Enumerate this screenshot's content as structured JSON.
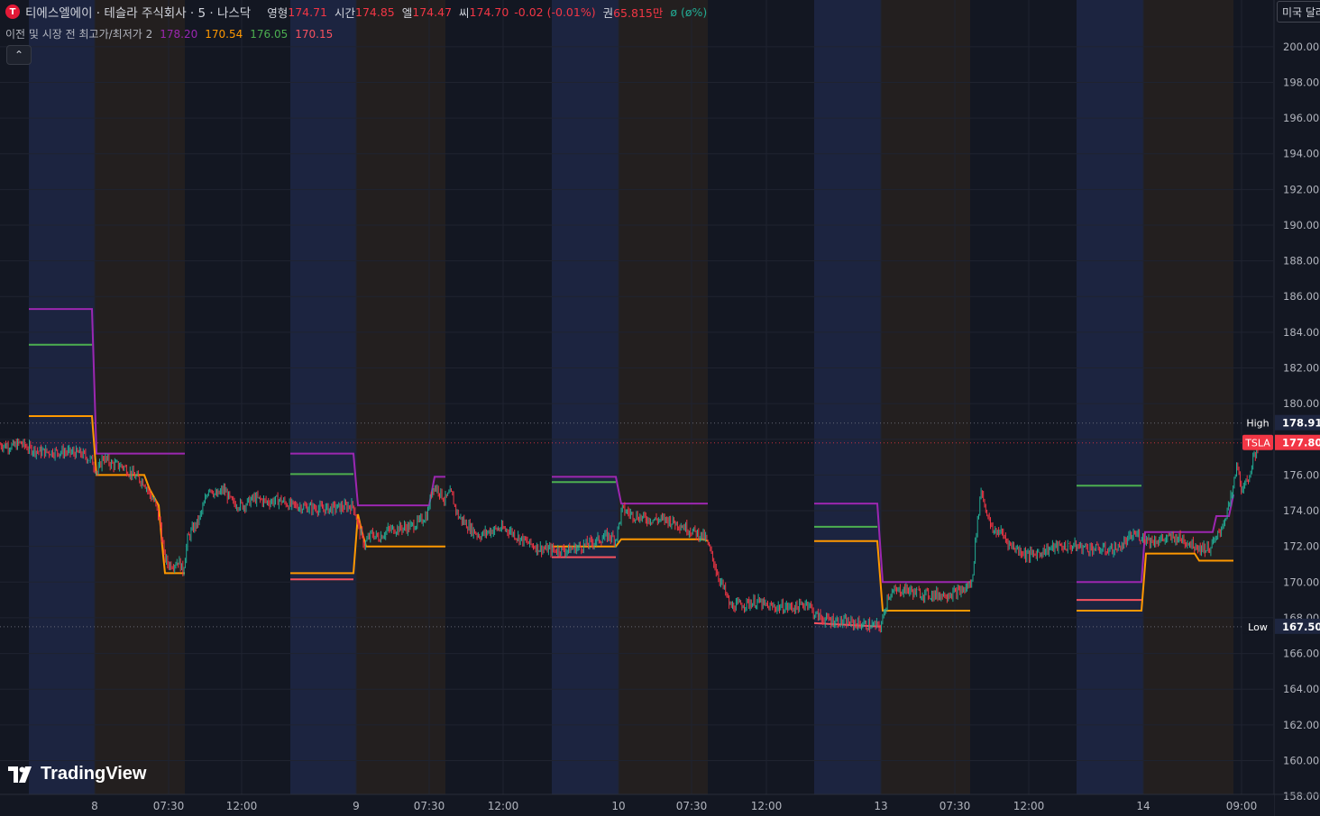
{
  "header": {
    "logo_letter": "T",
    "title": "티에스엘에이 · 테슬라 주식회사 · 5 · 나스닥",
    "ohlc": [
      {
        "label": "영형",
        "value": "174.71"
      },
      {
        "label": "시간",
        "value": "174.85"
      },
      {
        "label": "엘",
        "value": "174.47"
      },
      {
        "label": "씨",
        "value": "174.70"
      }
    ],
    "change": "-0.02 (-0.01%)",
    "volume_label": "권",
    "volume_value": "65.815만",
    "extra": "ø (ø%)"
  },
  "indicator": {
    "name": "이전 및 시장 전 최고가/최저가 2",
    "values": [
      {
        "value": "178.20",
        "color": "#9c27b0"
      },
      {
        "value": "170.54",
        "color": "#ff9800"
      },
      {
        "value": "176.05",
        "color": "#4caf50"
      },
      {
        "value": "170.15",
        "color": "#f7525f"
      }
    ]
  },
  "collapse_icon": "chevron-up-icon",
  "currency_button": "미국 달러",
  "watermark": "TradingView",
  "colors": {
    "background": "#131722",
    "premarket_band": "#1c2440",
    "postmarket_band": "#231f1f",
    "prev_high": "#9c27b0",
    "prev_low": "#f7525f",
    "pm_high": "#4caf50",
    "pm_low": "#ff9800",
    "up": "#22ab94",
    "down": "#f23645"
  },
  "chart_data": {
    "type": "line",
    "symbol": "TSLA",
    "y_axis": {
      "range": [
        157.5,
        201
      ],
      "ticks": [
        "158.00",
        "160.00",
        "162.00",
        "164.00",
        "166.00",
        "168.00",
        "170.00",
        "172.00",
        "174.00",
        "176.00",
        "178.00",
        "180.00",
        "182.00",
        "184.00",
        "186.00",
        "188.00",
        "190.00",
        "192.00",
        "194.00",
        "196.00",
        "198.00",
        "200.00"
      ]
    },
    "x_axis": {
      "range": [
        0,
        1464
      ],
      "ticks": [
        {
          "x": 105,
          "label": "8"
        },
        {
          "x": 187,
          "label": "07:30"
        },
        {
          "x": 268,
          "label": "12:00"
        },
        {
          "x": 395,
          "label": "9"
        },
        {
          "x": 476,
          "label": "07:30"
        },
        {
          "x": 558,
          "label": "12:00"
        },
        {
          "x": 686,
          "label": "10"
        },
        {
          "x": 767,
          "label": "07:30"
        },
        {
          "x": 850,
          "label": "12:00"
        },
        {
          "x": 977,
          "label": "13"
        },
        {
          "x": 1059,
          "label": "07:30"
        },
        {
          "x": 1141,
          "label": "12:00"
        },
        {
          "x": 1268,
          "label": "14"
        },
        {
          "x": 1377,
          "label": "09:00"
        }
      ]
    },
    "price_labels": [
      {
        "name": "High",
        "value": 178.91,
        "text": "178.91"
      },
      {
        "name": "TSLA",
        "value": 177.8,
        "text": "177.80"
      },
      {
        "name": "Low",
        "value": 167.5,
        "text": "167.50"
      }
    ],
    "session_bands": [
      {
        "type": "pre",
        "x0": 32,
        "x1": 105
      },
      {
        "type": "post",
        "x0": 105,
        "x1": 205
      },
      {
        "type": "pre",
        "x0": 322,
        "x1": 395
      },
      {
        "type": "post",
        "x0": 395,
        "x1": 494
      },
      {
        "type": "pre",
        "x0": 612,
        "x1": 686
      },
      {
        "type": "post",
        "x0": 686,
        "x1": 785
      },
      {
        "type": "pre",
        "x0": 903,
        "x1": 977
      },
      {
        "type": "post",
        "x0": 977,
        "x1": 1076
      },
      {
        "type": "pre",
        "x0": 1194,
        "x1": 1268
      },
      {
        "type": "post",
        "x0": 1268,
        "x1": 1368
      }
    ],
    "series": [
      {
        "name": "prev_high",
        "color": "#9c27b0",
        "segments": [
          [
            [
              32,
              185.3
            ],
            [
              102,
              185.3
            ],
            [
              107,
              177.2
            ],
            [
              205,
              177.2
            ]
          ],
          [
            [
              322,
              177.2
            ],
            [
              392,
              177.2
            ],
            [
              397,
              174.3
            ],
            [
              476,
              174.3
            ],
            [
              482,
              175.9
            ],
            [
              494,
              175.9
            ]
          ],
          [
            [
              612,
              175.9
            ],
            [
              683,
              175.9
            ],
            [
              689,
              174.4
            ],
            [
              785,
              174.4
            ]
          ],
          [
            [
              903,
              174.4
            ],
            [
              973,
              174.4
            ],
            [
              979,
              170.0
            ],
            [
              1076,
              170.0
            ]
          ],
          [
            [
              1194,
              170.0
            ],
            [
              1266,
              170.0
            ],
            [
              1270,
              172.8
            ],
            [
              1345,
              172.8
            ],
            [
              1349,
              173.7
            ],
            [
              1363,
              173.7
            ],
            [
              1368,
              174.9
            ]
          ]
        ]
      },
      {
        "name": "pm_high",
        "color": "#4caf50",
        "segments": [
          [
            [
              32,
              183.3
            ],
            [
              102,
              183.3
            ]
          ],
          [
            [
              322,
              176.05
            ],
            [
              392,
              176.05
            ]
          ],
          [
            [
              612,
              175.6
            ],
            [
              683,
              175.6
            ]
          ],
          [
            [
              903,
              173.1
            ],
            [
              973,
              173.1
            ]
          ],
          [
            [
              1194,
              175.4
            ],
            [
              1266,
              175.4
            ]
          ]
        ]
      },
      {
        "name": "pm_low",
        "color": "#ff9800",
        "segments": [
          [
            [
              32,
              179.3
            ],
            [
              102,
              179.3
            ],
            [
              107,
              176.0
            ],
            [
              160,
              176.0
            ],
            [
              166,
              175.2
            ],
            [
              176,
              174.3
            ],
            [
              180,
              172.0
            ],
            [
              183,
              170.5
            ],
            [
              205,
              170.5
            ]
          ],
          [
            [
              322,
              170.5
            ],
            [
              392,
              170.5
            ],
            [
              397,
              173.8
            ],
            [
              401,
              172.9
            ],
            [
              406,
              172.0
            ],
            [
              494,
              172.0
            ]
          ],
          [
            [
              612,
              172.0
            ],
            [
              683,
              172.0
            ],
            [
              689,
              172.4
            ],
            [
              780,
              172.4
            ],
            [
              785,
              172.3
            ]
          ],
          [
            [
              903,
              172.3
            ],
            [
              973,
              172.3
            ],
            [
              979,
              168.4
            ],
            [
              1076,
              168.4
            ]
          ],
          [
            [
              1194,
              168.4
            ],
            [
              1266,
              168.4
            ],
            [
              1271,
              171.6
            ],
            [
              1325,
              171.6
            ],
            [
              1330,
              171.2
            ],
            [
              1368,
              171.2
            ]
          ]
        ]
      },
      {
        "name": "prev_low",
        "color": "#f7525f",
        "segments": [
          [
            [
              322,
              170.15
            ],
            [
              392,
              170.15
            ]
          ],
          [
            [
              612,
              171.4
            ],
            [
              683,
              171.4
            ]
          ],
          [
            [
              903,
              167.7
            ],
            [
              977,
              167.5
            ]
          ],
          [
            [
              1194,
              169.0
            ],
            [
              1266,
              169.0
            ]
          ]
        ]
      },
      {
        "name": "TSLA",
        "color": "#22ab94",
        "segments": [
          [
            [
              0,
              177.7
            ],
            [
              15,
              177.6
            ],
            [
              22,
              177.8
            ],
            [
              32,
              177.5
            ],
            [
              45,
              177.3
            ],
            [
              70,
              177.3
            ],
            [
              90,
              177.2
            ],
            [
              102,
              176.8
            ],
            [
              108,
              176.1
            ],
            [
              114,
              177.0
            ],
            [
              124,
              176.6
            ],
            [
              136,
              176.5
            ],
            [
              150,
              175.9
            ],
            [
              160,
              175.6
            ],
            [
              166,
              174.9
            ],
            [
              172,
              174.4
            ],
            [
              178,
              173.2
            ],
            [
              182,
              171.5
            ],
            [
              186,
              171.0
            ],
            [
              192,
              171.0
            ],
            [
              198,
              171.2
            ],
            [
              203,
              170.6
            ],
            [
              208,
              172.4
            ],
            [
              214,
              173.0
            ],
            [
              220,
              173.4
            ],
            [
              226,
              174.3
            ],
            [
              232,
              175.4
            ],
            [
              240,
              174.8
            ],
            [
              248,
              175.2
            ],
            [
              258,
              174.4
            ],
            [
              270,
              174.3
            ],
            [
              282,
              174.7
            ],
            [
              296,
              174.5
            ],
            [
              310,
              174.6
            ],
            [
              322,
              174.3
            ],
            [
              340,
              174.2
            ],
            [
              360,
              174.1
            ],
            [
              380,
              174.2
            ],
            [
              392,
              174.3
            ],
            [
              398,
              173.0
            ],
            [
              404,
              172.1
            ],
            [
              412,
              172.7
            ],
            [
              420,
              172.5
            ],
            [
              430,
              172.9
            ],
            [
              440,
              173.0
            ],
            [
              455,
              173.1
            ],
            [
              466,
              173.4
            ],
            [
              474,
              173.8
            ],
            [
              480,
              175.4
            ],
            [
              486,
              175.2
            ],
            [
              493,
              174.6
            ],
            [
              500,
              175.0
            ],
            [
              508,
              173.7
            ],
            [
              516,
              173.3
            ],
            [
              522,
              173.0
            ],
            [
              532,
              172.6
            ],
            [
              545,
              172.9
            ],
            [
              555,
              173.0
            ],
            [
              565,
              172.9
            ],
            [
              575,
              172.5
            ],
            [
              585,
              172.2
            ],
            [
              598,
              171.9
            ],
            [
              612,
              171.8
            ],
            [
              630,
              171.8
            ],
            [
              645,
              172.0
            ],
            [
              660,
              172.3
            ],
            [
              675,
              172.6
            ],
            [
              683,
              172.4
            ],
            [
              690,
              174.1
            ],
            [
              700,
              173.8
            ],
            [
              712,
              173.6
            ],
            [
              725,
              173.5
            ],
            [
              740,
              173.5
            ],
            [
              755,
              173.2
            ],
            [
              770,
              172.8
            ],
            [
              782,
              172.5
            ],
            [
              790,
              171.4
            ],
            [
              796,
              170.4
            ],
            [
              803,
              169.6
            ],
            [
              810,
              168.6
            ],
            [
              818,
              168.7
            ],
            [
              828,
              168.8
            ],
            [
              840,
              168.9
            ],
            [
              852,
              168.6
            ],
            [
              862,
              168.6
            ],
            [
              874,
              168.6
            ],
            [
              886,
              168.6
            ],
            [
              896,
              168.9
            ],
            [
              903,
              168.2
            ],
            [
              915,
              167.9
            ],
            [
              930,
              167.8
            ],
            [
              945,
              167.7
            ],
            [
              960,
              167.6
            ],
            [
              977,
              167.5
            ],
            [
              985,
              169.3
            ],
            [
              995,
              169.5
            ],
            [
              1005,
              169.6
            ],
            [
              1015,
              169.4
            ],
            [
              1030,
              169.3
            ],
            [
              1045,
              169.3
            ],
            [
              1060,
              169.4
            ],
            [
              1070,
              169.6
            ],
            [
              1078,
              170.0
            ],
            [
              1082,
              172.4
            ],
            [
              1088,
              175.2
            ],
            [
              1094,
              174.0
            ],
            [
              1100,
              172.9
            ],
            [
              1110,
              172.8
            ],
            [
              1120,
              172.1
            ],
            [
              1130,
              171.8
            ],
            [
              1140,
              171.5
            ],
            [
              1150,
              171.6
            ],
            [
              1160,
              171.8
            ],
            [
              1172,
              172.0
            ],
            [
              1185,
              172.0
            ],
            [
              1194,
              172.0
            ],
            [
              1210,
              171.9
            ],
            [
              1225,
              171.8
            ],
            [
              1240,
              171.9
            ],
            [
              1250,
              172.3
            ],
            [
              1258,
              172.7
            ],
            [
              1268,
              172.5
            ],
            [
              1278,
              172.3
            ],
            [
              1290,
              172.4
            ],
            [
              1305,
              172.5
            ],
            [
              1320,
              172.2
            ],
            [
              1332,
              171.9
            ],
            [
              1342,
              171.9
            ],
            [
              1350,
              172.5
            ],
            [
              1358,
              173.5
            ],
            [
              1366,
              174.8
            ],
            [
              1372,
              176.6
            ],
            [
              1378,
              175.0
            ],
            [
              1384,
              175.8
            ],
            [
              1390,
              176.8
            ],
            [
              1396,
              177.8
            ]
          ]
        ]
      }
    ]
  }
}
